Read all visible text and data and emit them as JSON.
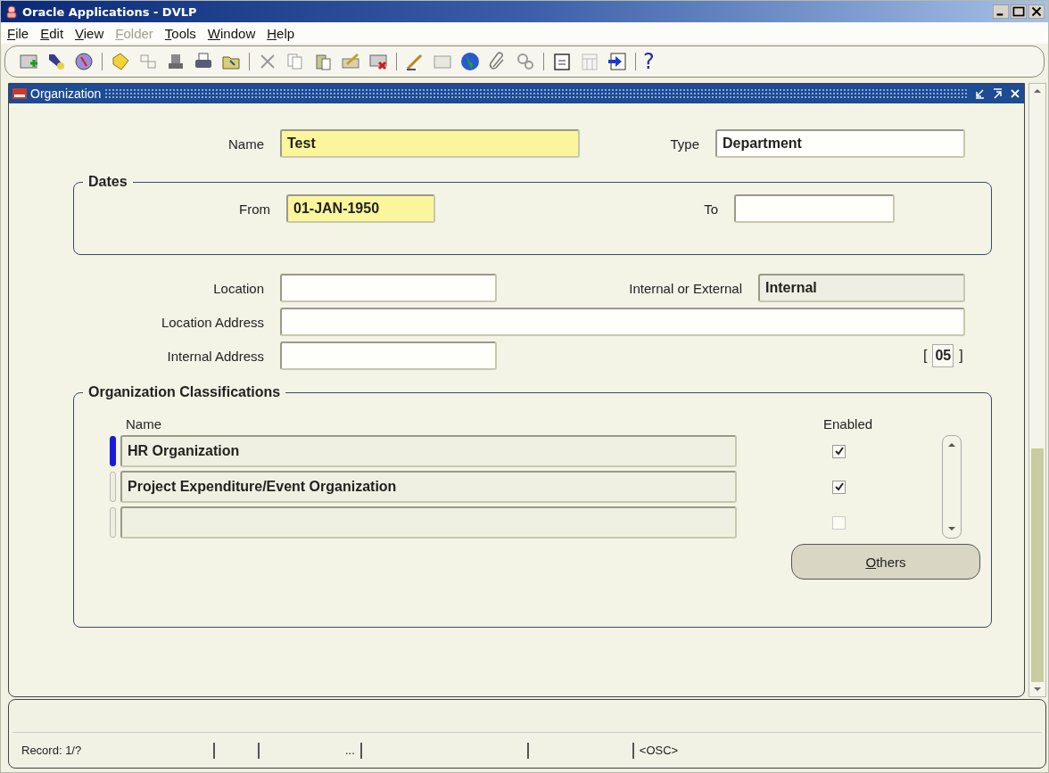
{
  "window": {
    "title": "Oracle Applications - DVLP"
  },
  "menu": [
    {
      "label": "File",
      "disabled": false
    },
    {
      "label": "Edit",
      "disabled": false
    },
    {
      "label": "View",
      "disabled": false
    },
    {
      "label": "Folder",
      "disabled": true
    },
    {
      "label": "Tools",
      "disabled": false
    },
    {
      "label": "Window",
      "disabled": false
    },
    {
      "label": "Help",
      "disabled": false
    }
  ],
  "toolbar": {
    "help": "?"
  },
  "form": {
    "title": "Organization",
    "name": {
      "label": "Name",
      "value": "Test",
      "required": true,
      "readonly": false
    },
    "type": {
      "label": "Type",
      "value": "Department",
      "required": false,
      "readonly": false
    },
    "dates": {
      "legend": "Dates",
      "from": {
        "label": "From",
        "value": "01-JAN-1950",
        "required": true,
        "readonly": false
      },
      "to": {
        "label": "To",
        "required": false,
        "readonly": false
      }
    },
    "location": {
      "label": "Location",
      "required": false,
      "readonly": false
    },
    "internal_external": {
      "label": "Internal or External",
      "value": "Internal",
      "required": false,
      "readonly": true
    },
    "location_address": {
      "label": "Location Address",
      "required": false,
      "readonly": false
    },
    "internal_address": {
      "label": "Internal Address",
      "required": false,
      "readonly": false
    },
    "bracket_left": "[",
    "bracket_value": "05",
    "bracket_right": "]",
    "classifications": {
      "legend": "Organization Classifications",
      "name_header": "Name",
      "enabled_header": "Enabled",
      "rows": [
        {
          "name": "HR Organization",
          "current": true,
          "checked": true,
          "disabled": false
        },
        {
          "name": "Project Expenditure/Event Organization",
          "current": false,
          "checked": true,
          "disabled": false
        },
        {
          "current": false,
          "checked": false,
          "disabled": true
        }
      ],
      "others_button": "Others"
    }
  },
  "status_bar": {
    "record": "Record: 1/?",
    "ellipsis": "...",
    "mode": "<OSC>"
  }
}
